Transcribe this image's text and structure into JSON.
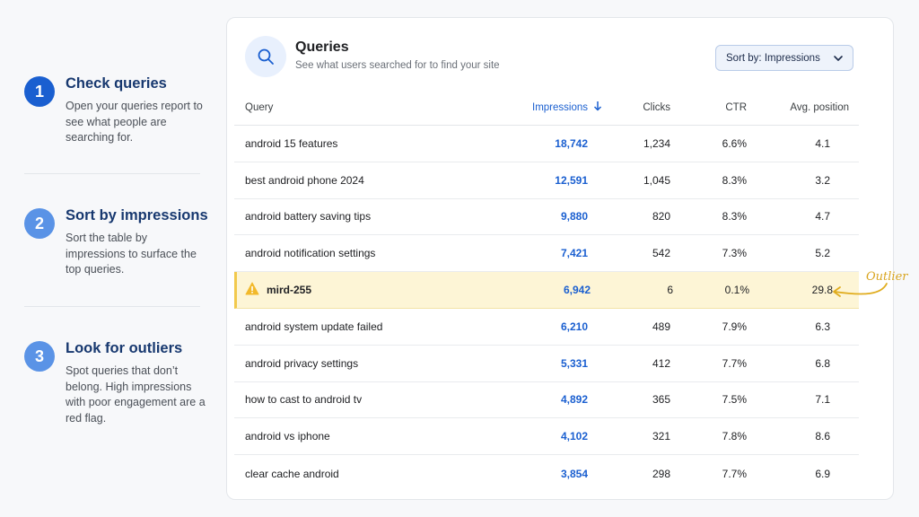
{
  "steps": [
    {
      "number": "1",
      "title": "Check queries",
      "body": "Open your queries report to see what people are searching for."
    },
    {
      "number": "2",
      "title": "Sort by impressions",
      "body": "Sort the table by impressions to surface the top queries."
    },
    {
      "number": "3",
      "title": "Look for outliers",
      "body": "Spot queries that don’t belong. High impressions with poor engagement are a red flag."
    }
  ],
  "card": {
    "title": "Queries",
    "subtitle": "See what users searched for to find your site",
    "sort_label": "Sort by: Impressions"
  },
  "table": {
    "headers": {
      "query": "Query",
      "impressions": "Impressions",
      "clicks": "Clicks",
      "ctr": "CTR",
      "position": "Avg. position"
    },
    "rows": [
      {
        "query": "android 15 features",
        "impressions": "18,742",
        "clicks": "1,234",
        "ctr": "6.6%",
        "position": "4.1"
      },
      {
        "query": "best android phone 2024",
        "impressions": "12,591",
        "clicks": "1,045",
        "ctr": "8.3%",
        "position": "3.2"
      },
      {
        "query": "android battery saving tips",
        "impressions": "9,880",
        "clicks": "820",
        "ctr": "8.3%",
        "position": "4.7"
      },
      {
        "query": "android notification settings",
        "impressions": "7,421",
        "clicks": "542",
        "ctr": "7.3%",
        "position": "5.2"
      },
      {
        "query": "mird-255",
        "impressions": "6,942",
        "clicks": "6",
        "ctr": "0.1%",
        "position": "29.8"
      },
      {
        "query": "android system update failed",
        "impressions": "6,210",
        "clicks": "489",
        "ctr": "7.9%",
        "position": "6.3"
      },
      {
        "query": "android privacy settings",
        "impressions": "5,331",
        "clicks": "412",
        "ctr": "7.7%",
        "position": "6.8"
      },
      {
        "query": "how to cast to android tv",
        "impressions": "4,892",
        "clicks": "365",
        "ctr": "7.5%",
        "position": "7.1"
      },
      {
        "query": "android vs iphone",
        "impressions": "4,102",
        "clicks": "321",
        "ctr": "7.8%",
        "position": "8.6"
      },
      {
        "query": "clear cache android",
        "impressions": "3,854",
        "clicks": "298",
        "ctr": "7.7%",
        "position": "6.9"
      }
    ]
  },
  "annotation": {
    "outlier_label": "Outlier"
  },
  "icons": {
    "search": "search-icon",
    "sort_arrow": "arrow-down-icon",
    "dropdown": "chevron-down-icon",
    "warning": "warning-icon"
  },
  "colors": {
    "accent": "#1a5fd0",
    "highlight": "#fdf5d6",
    "annotation": "#d9a520"
  }
}
